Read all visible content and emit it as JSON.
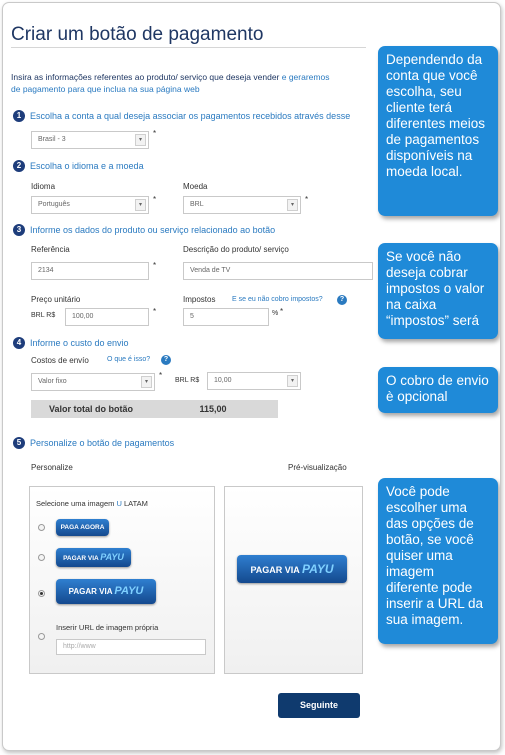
{
  "page_title": "Criar um botão de pagamento",
  "intro": {
    "text": "Insira as informações referentes ao produto/ serviço que deseja vender ",
    "highlight": "e geraremos",
    "text2": "de pagamento para que inclua na sua página web"
  },
  "steps": [
    {
      "num": "1",
      "label": "Escolha a conta a qual deseja associar os pagamentos recebidos através desse"
    },
    {
      "num": "2",
      "label": "Escolha o idioma e a moeda"
    },
    {
      "num": "3",
      "label": "Informe os dados do produto ou serviço relacionado ao botão"
    },
    {
      "num": "4",
      "label": "Informe o custo do envio"
    },
    {
      "num": "5",
      "label": "Personalize o botão de pagamentos"
    }
  ],
  "account": {
    "value": "Brasil - 3"
  },
  "language": {
    "label": "Idioma",
    "value": "Português"
  },
  "currency": {
    "label": "Moeda",
    "value": "BRL"
  },
  "reference": {
    "label": "Referência",
    "value": "2134"
  },
  "description": {
    "label": "Descrição do produto/ serviço",
    "value": "Venda de TV"
  },
  "unit_price": {
    "label": "Preço unitário",
    "prefix": "BRL R$",
    "value": "100,00"
  },
  "taxes": {
    "label": "Impostos",
    "link": "E se eu não cobro impostos?",
    "value": "5",
    "suffix": "%"
  },
  "shipping": {
    "label": "Costos de envío",
    "link": "O que é isso?",
    "type_value": "Valor fixo",
    "prefix": "BRL R$",
    "value": "10,00"
  },
  "total": {
    "label": "Valor total do botão",
    "value": "115,00"
  },
  "required_mark": "*",
  "help_mark": "?",
  "personalize": {
    "label": "Personalize",
    "preview_label": "Pré-visualização",
    "select_image_text": "Selecione uma imagem ",
    "select_image_u": "U",
    "select_image_rest": " LATAM",
    "options": [
      {
        "text": "PAGA AGORA"
      },
      {
        "text": "PAGAR VIA ",
        "brand": "PAYU"
      },
      {
        "text": "PAGAR VIA ",
        "brand": "PAYU"
      }
    ],
    "custom_url_label": "Inserir URL de imagem própria",
    "custom_url_placeholder": "http://www",
    "preview_button": {
      "text": "PAGAR VIA ",
      "brand": "PAYU"
    }
  },
  "next_button": "Seguinte",
  "tips": [
    "Dependendo da conta que você escolha, seu cliente terá diferentes meios de pagamentos disponíveis na moeda local.",
    "Se você não deseja cobrar impostos o valor na caixa “impostos” será",
    "O cobro de envio è opcional",
    "Você pode escolher uma das opções de botão, se você quiser uma imagem diferente pode inserir a URL da sua imagem."
  ],
  "colors": {
    "accent": "#2a7ac0",
    "title": "#1f3763",
    "tip_bg": "#1f8ad8",
    "button_dark": "#0f3a6e"
  }
}
